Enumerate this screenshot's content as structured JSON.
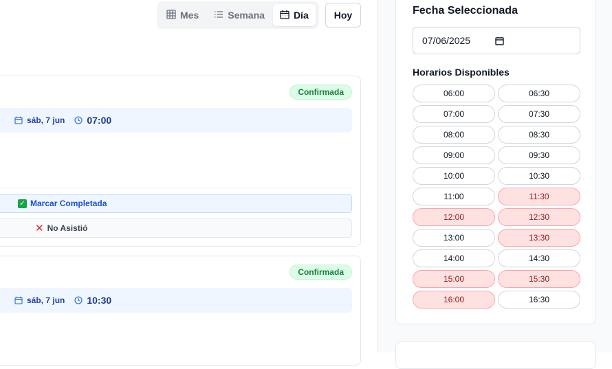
{
  "view_toggle": {
    "items": [
      {
        "label": "Mes",
        "icon": "grid-icon"
      },
      {
        "label": "Semana",
        "icon": "list-icon"
      },
      {
        "label": "Día",
        "icon": "calendar-icon",
        "active": true
      }
    ],
    "today_label": "Hoy"
  },
  "appointments": [
    {
      "status": "Confirmada",
      "date": "sáb, 7 jun",
      "time": "07:00",
      "actions": {
        "complete": "Marcar Completada",
        "no_show": "No Asistió"
      }
    },
    {
      "status": "Confirmada",
      "date": "sáb, 7 jun",
      "time": "10:30"
    }
  ],
  "sidebar": {
    "title": "Fecha Seleccionada",
    "date_value": "07/06/2025",
    "slots_label": "Horarios Disponibles",
    "slots": [
      {
        "time": "06:00",
        "busy": false
      },
      {
        "time": "06:30",
        "busy": false
      },
      {
        "time": "07:00",
        "busy": false
      },
      {
        "time": "07:30",
        "busy": false
      },
      {
        "time": "08:00",
        "busy": false
      },
      {
        "time": "08:30",
        "busy": false
      },
      {
        "time": "09:00",
        "busy": false
      },
      {
        "time": "09:30",
        "busy": false
      },
      {
        "time": "10:00",
        "busy": false
      },
      {
        "time": "10:30",
        "busy": false
      },
      {
        "time": "11:00",
        "busy": false
      },
      {
        "time": "11:30",
        "busy": true
      },
      {
        "time": "12:00",
        "busy": true
      },
      {
        "time": "12:30",
        "busy": true
      },
      {
        "time": "13:00",
        "busy": false
      },
      {
        "time": "13:30",
        "busy": true
      },
      {
        "time": "14:00",
        "busy": false
      },
      {
        "time": "14:30",
        "busy": false
      },
      {
        "time": "15:00",
        "busy": true
      },
      {
        "time": "15:30",
        "busy": true
      },
      {
        "time": "16:00",
        "busy": true
      },
      {
        "time": "16:30",
        "busy": false
      }
    ]
  },
  "colors": {
    "busy_bg": "#fee2e2",
    "confirmed": "#15803d",
    "accent": "#1d4ed8"
  }
}
